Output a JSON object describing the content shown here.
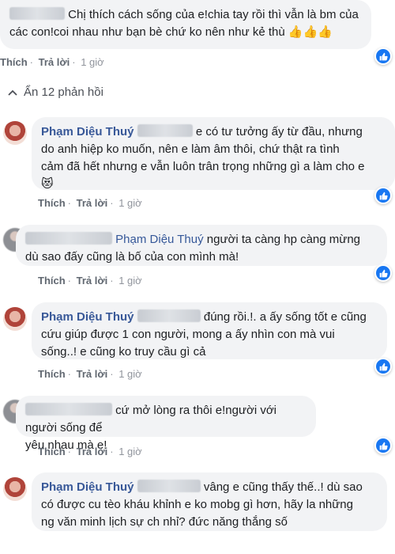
{
  "top_comment": {
    "text_line1": "Chị thích cách sống của e!chia tay rồi thì vẫn là bm của",
    "text_line2": "các con!coi nhau như bạn bè chứ ko nên như kẻ thù",
    "emoji": "👍👍👍",
    "like_label": "Thích",
    "reply_label": "Trả lời",
    "time": "1 giờ"
  },
  "toggle": {
    "icon": "chevron-up-icon",
    "label": "Ẩn 12 phản hồi"
  },
  "replies": [
    {
      "author": "Phạm Diệu Thuý",
      "line1": "e có tư tưởng ấy từ đầu, nhưng",
      "line2": "do anh hiệp ko muốn, nên e làm âm thôi, chứ thật ra tình",
      "line3": "cảm đã hết nhưng e vẫn luôn trân trọng những gì a làm cho e",
      "emoji": "😻",
      "like_label": "Thích",
      "reply_label": "Trả lời",
      "time": "1 giờ"
    },
    {
      "mention": "Phạm Diệu Thuý",
      "line1": "người ta càng hp càng mừng",
      "line2": "dù sao đấy cũng là bố của con mình mà!",
      "like_label": "Thích",
      "reply_label": "Trả lời",
      "time": "1 giờ"
    },
    {
      "author": "Phạm Diệu Thuý",
      "line1": "đúng rồi.!. a ấy sống tốt e cũng",
      "line2": "cứu giúp được 1 con người, mong a ấy nhìn con mà vui",
      "line3": "sống..! e cũng ko truy cầu gì cả",
      "like_label": "Thích",
      "reply_label": "Trả lời",
      "time": "1 giờ"
    },
    {
      "line1": "cứ mở lòng ra thôi e!người với người sống để",
      "line2": "yêu nhau mà e!",
      "like_label": "Thích",
      "reply_label": "Trả lời",
      "time": "1 giờ"
    },
    {
      "author": "Phạm Diệu Thuý",
      "line1": "vâng e cũng thấy thế..! dù sao",
      "line2": "có được cu tèo kháu khỉnh e ko mobg gì hơn, hãy la những",
      "line3": "ng văn minh lịch sự ch nhỉ? đức năng thắng số"
    }
  ],
  "colors": {
    "accent": "#385898",
    "bubble": "#f2f3f5",
    "like": "#1877f2"
  }
}
